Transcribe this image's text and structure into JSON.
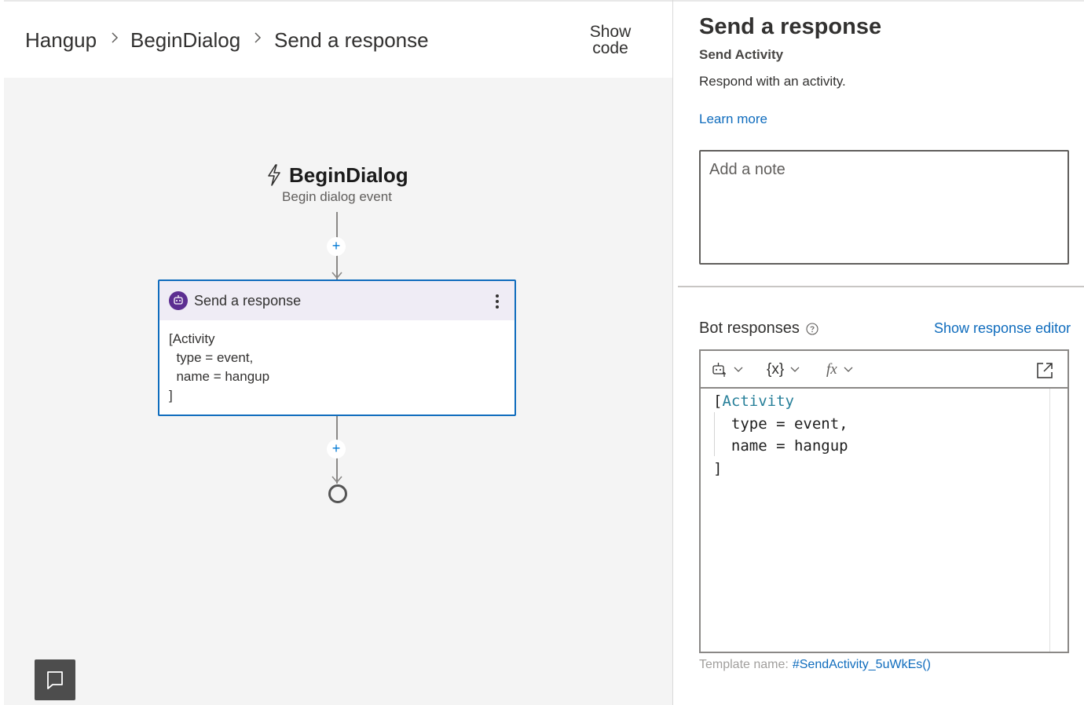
{
  "breadcrumb": {
    "items": [
      "Hangup",
      "BeginDialog",
      "Send a response"
    ],
    "show_code": [
      "Show",
      "code"
    ]
  },
  "canvas": {
    "trigger": {
      "title": "BeginDialog",
      "subtitle": "Begin dialog event",
      "icon": "lightning-icon"
    },
    "add_button_label": "+",
    "action_card": {
      "title": "Send a response",
      "icon": "bot-icon",
      "body": "[Activity\n  type = event,\n  name = hangup\n]"
    },
    "end_node": "end-circle",
    "bottom_button_icon": "comment-icon"
  },
  "properties": {
    "title": "Send a response",
    "subtitle": "Send Activity",
    "description": "Respond with an activity.",
    "learn_more": "Learn more",
    "note_placeholder": "Add a note",
    "bot_responses_label": "Bot responses",
    "show_response_editor": "Show response editor",
    "toolbar": {
      "template_icon": "bot-template-icon",
      "variables_label": "{x}",
      "functions_label": "fx",
      "popout_icon": "popout-icon"
    },
    "code": {
      "bracket_open": "[",
      "keyword": "Activity",
      "line2": "  type = event,",
      "line3": "  name = hangup",
      "line4": "]"
    },
    "template_name_label": "Template name:",
    "template_name": "#SendActivity_5uWkEs()"
  },
  "colors": {
    "link": "#0f6cbd",
    "card_border": "#0f6cbd",
    "card_header": "#efecf5",
    "bot_icon_bg": "#5c2e91",
    "canvas_bg": "#f4f4f4"
  }
}
